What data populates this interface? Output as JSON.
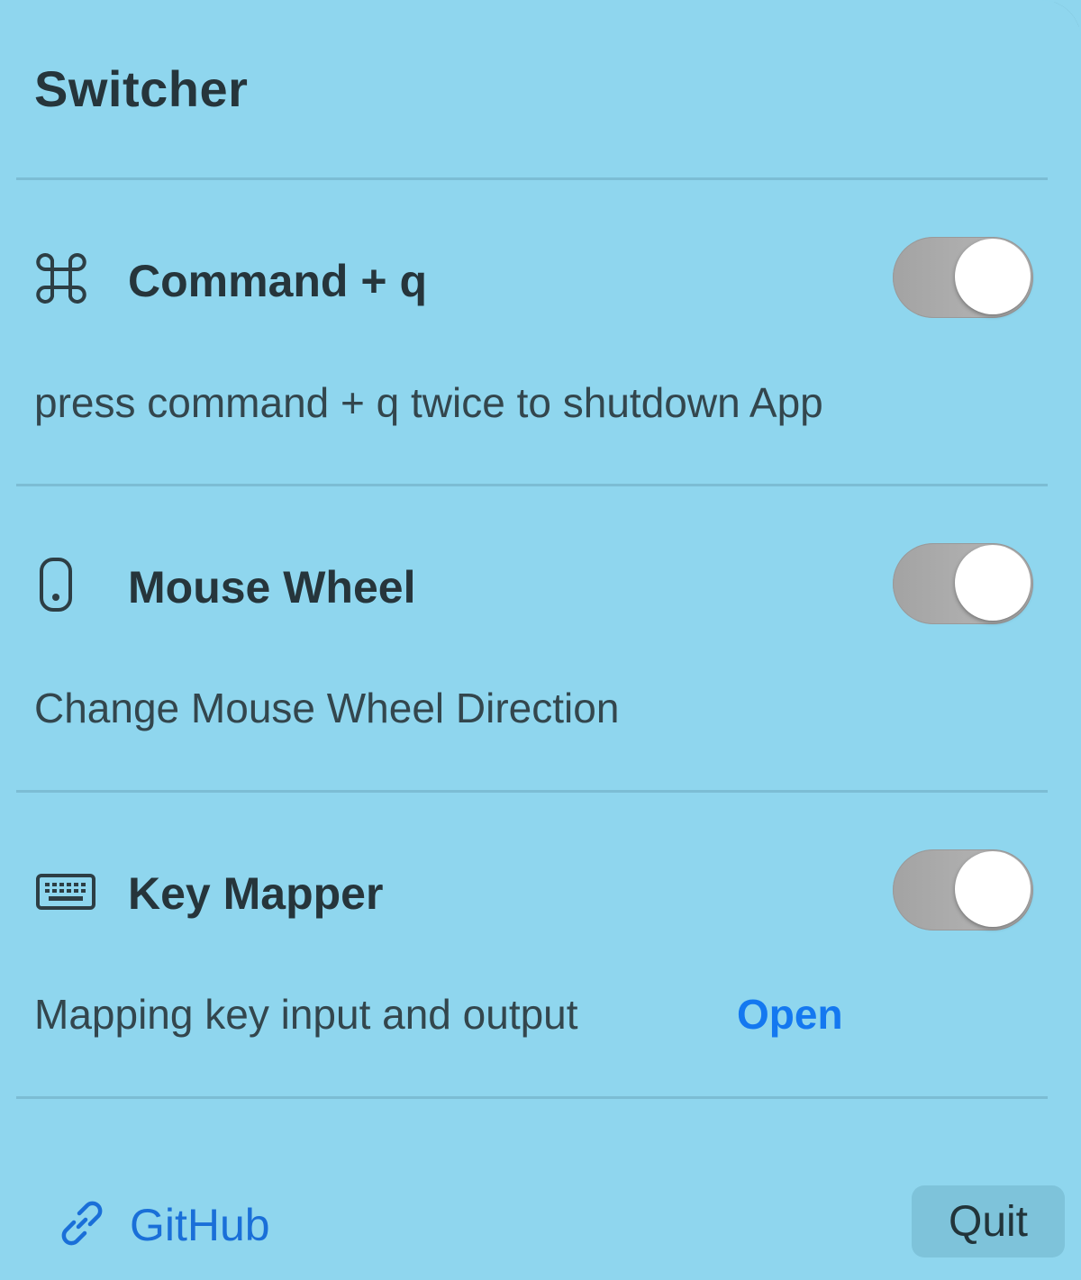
{
  "header": {
    "title": "Switcher"
  },
  "features": [
    {
      "icon": "command-icon",
      "label": "Command + q",
      "description": "press command + q twice to shutdown App",
      "enabled": true
    },
    {
      "icon": "mouse-icon",
      "label": "Mouse Wheel",
      "description": "Change Mouse Wheel Direction",
      "enabled": true
    },
    {
      "icon": "keyboard-icon",
      "label": "Key Mapper",
      "description": "Mapping key input and output",
      "action_label": "Open",
      "enabled": true
    }
  ],
  "footer": {
    "link_icon": "link-icon",
    "github_label": "GitHub",
    "quit_label": "Quit"
  },
  "colors": {
    "background": "#8fd6ee",
    "link": "#1478f0",
    "toggle_track": "#b0b0b0"
  }
}
